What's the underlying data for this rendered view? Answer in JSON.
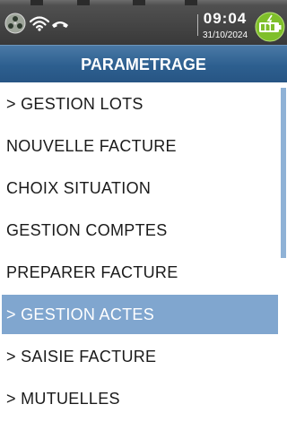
{
  "status_bar": {
    "time": "09:04",
    "date": "31/10/2024",
    "icons": [
      "signal-icon",
      "wifi-icon",
      "phone-hangup-icon",
      "battery-charging-icon"
    ],
    "colors": {
      "battery": "#7fbf2a",
      "background": "#3c3c3c"
    }
  },
  "header": {
    "title": "PARAMETRAGE",
    "color": "#2d5f8f"
  },
  "menu": {
    "items": [
      {
        "label": "> GESTION LOTS"
      },
      {
        "label": "NOUVELLE FACTURE"
      },
      {
        "label": "CHOIX SITUATION"
      },
      {
        "label": "GESTION COMPTES"
      },
      {
        "label": "PREPARER FACTURE"
      },
      {
        "label": "> GESTION ACTES",
        "selected": true
      },
      {
        "label": "> SAISIE FACTURE"
      },
      {
        "label": "> MUTUELLES"
      }
    ],
    "selected_index": 5,
    "selected_color": "#80a6cf"
  }
}
